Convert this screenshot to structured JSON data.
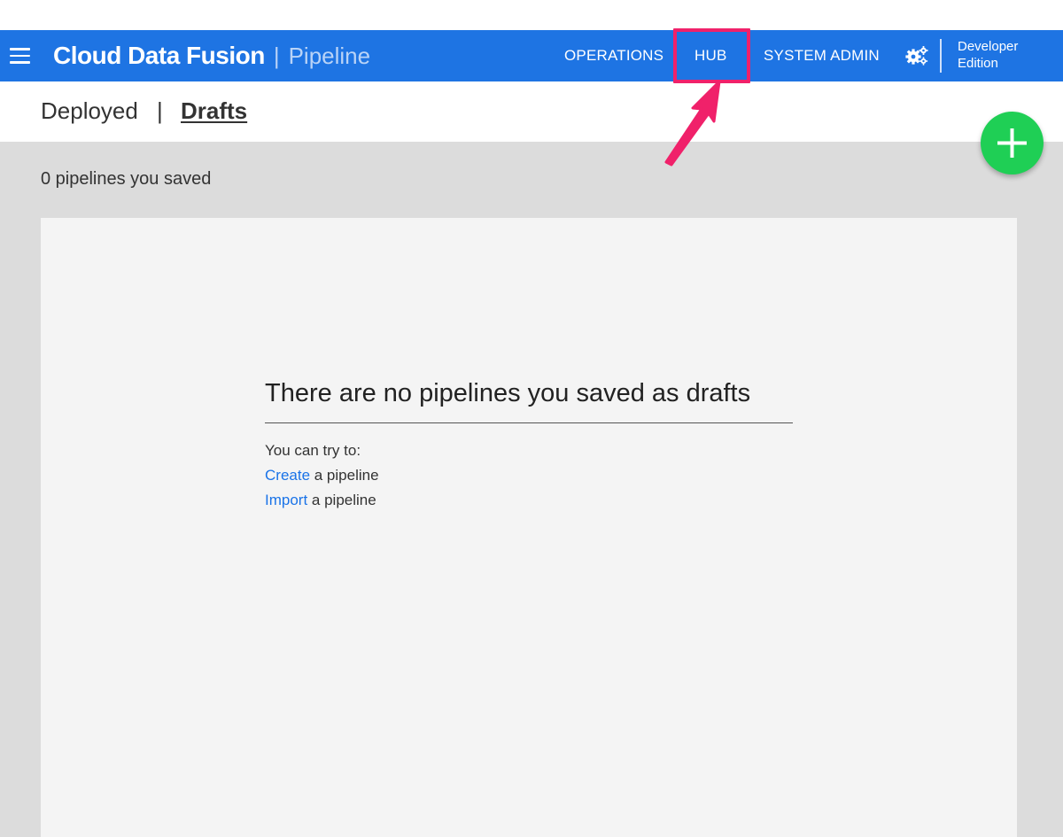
{
  "header": {
    "brand_name": "Cloud Data Fusion",
    "brand_separator": "|",
    "brand_section": "Pipeline",
    "nav": {
      "operations": "OPERATIONS",
      "hub": "HUB",
      "system_admin": "SYSTEM ADMIN"
    },
    "edition_line1": "Developer",
    "edition_line2": "Edition"
  },
  "tabs": {
    "deployed": "Deployed",
    "separator": "|",
    "drafts": "Drafts",
    "active": "Drafts"
  },
  "summary": {
    "count_text": "0 pipelines you saved"
  },
  "empty_state": {
    "title": "There are no pipelines you saved as drafts",
    "intro": "You can try to:",
    "create_link": "Create",
    "create_suffix": " a pipeline",
    "import_link": "Import",
    "import_suffix": " a pipeline"
  },
  "colors": {
    "header_bg": "#1e74e3",
    "highlight": "#f0216a",
    "fab": "#1fcf55",
    "link": "#1a73e8",
    "content_bg": "#dcdcdc",
    "panel_bg": "#f4f4f4"
  },
  "icons": {
    "menu": "hamburger-menu-icon",
    "settings": "gears-icon",
    "add": "plus-icon",
    "annotation": "arrow-pointer-icon"
  }
}
